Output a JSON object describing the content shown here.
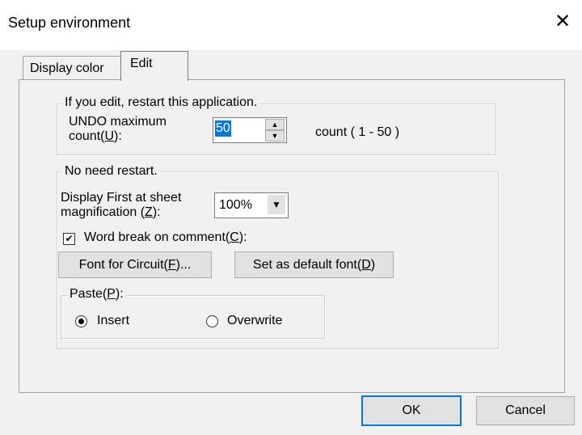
{
  "window": {
    "title": "Setup environment",
    "close_icon": "close-icon"
  },
  "tabs": [
    {
      "label": "Display color"
    },
    {
      "label": "Edit"
    }
  ],
  "group_restart": {
    "legend": "If you edit, restart this application.",
    "undo_label_line1": "UNDO maximum",
    "undo_label_line2_prefix": "count(",
    "undo_label_mnemonic": "U",
    "undo_label_line2_suffix": "):",
    "undo_value": "50",
    "undo_range": "count ( 1 - 50 )"
  },
  "group_norestart": {
    "legend": "No need restart.",
    "magnification_label_line1": "Display First at sheet",
    "magnification_label_line2_prefix": "magnification (",
    "magnification_label_mnemonic": "Z",
    "magnification_label_line2_suffix": "):",
    "magnification_value": "100%",
    "word_break_prefix": "Word break on comment(",
    "word_break_mnemonic": "C",
    "word_break_suffix": "):",
    "word_break_checked": true,
    "font_button_prefix": "Font for Circuit(",
    "font_button_mnemonic": "F",
    "font_button_suffix": ")...",
    "default_font_prefix": "Set as default font(",
    "default_font_mnemonic": "D",
    "default_font_suffix": ")",
    "paste": {
      "legend_prefix": "Paste(",
      "legend_mnemonic": "P",
      "legend_suffix": "):",
      "insert_label": "Insert",
      "overwrite_label": "Overwrite",
      "selected": "Insert"
    }
  },
  "footer": {
    "ok_label": "OK",
    "cancel_label": "Cancel"
  },
  "colors": {
    "selection": "#0078d7",
    "background": "#f0f0f0"
  }
}
